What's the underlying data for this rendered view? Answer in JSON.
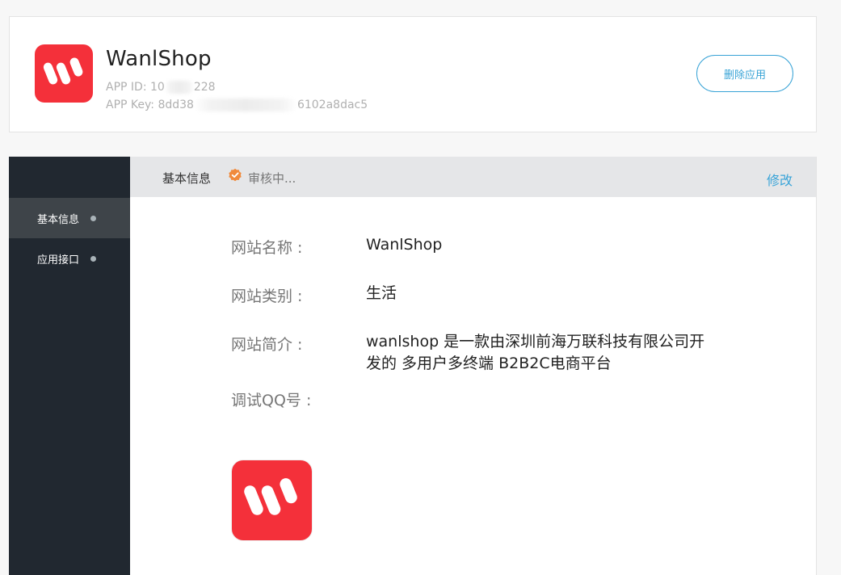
{
  "app": {
    "name": "WanlShop",
    "id_label": "APP ID:",
    "id_prefix": "10",
    "id_suffix": "228",
    "key_label": "APP Key:",
    "key_prefix": "8dd38",
    "key_suffix": "6102a8dac5",
    "logo_icon": "wanlshop-logo-icon",
    "brand_color": "#f4303a"
  },
  "header": {
    "delete_label": "删除应用"
  },
  "sidebar": {
    "items": [
      {
        "label": "基本信息",
        "active": true
      },
      {
        "label": "应用接口",
        "active": false
      }
    ]
  },
  "topbar": {
    "title": "基本信息",
    "status": "审核中...",
    "status_icon": "verified-badge-icon",
    "status_color": "#f08a3c",
    "edit_label": "修改"
  },
  "fields": {
    "name_label": "网站名称 :",
    "name_value": "WanlShop",
    "category_label": "网站类别 :",
    "category_value": "生活",
    "desc_label": "网站简介 :",
    "desc_value": "wanlshop 是一款由深圳前海万联科技有限公司开发的 多用户多终端 B2B2C电商平台",
    "qq_label": "调试QQ号 :"
  },
  "colors": {
    "accent": "#38a3d6",
    "sidebar_bg": "#212830"
  }
}
